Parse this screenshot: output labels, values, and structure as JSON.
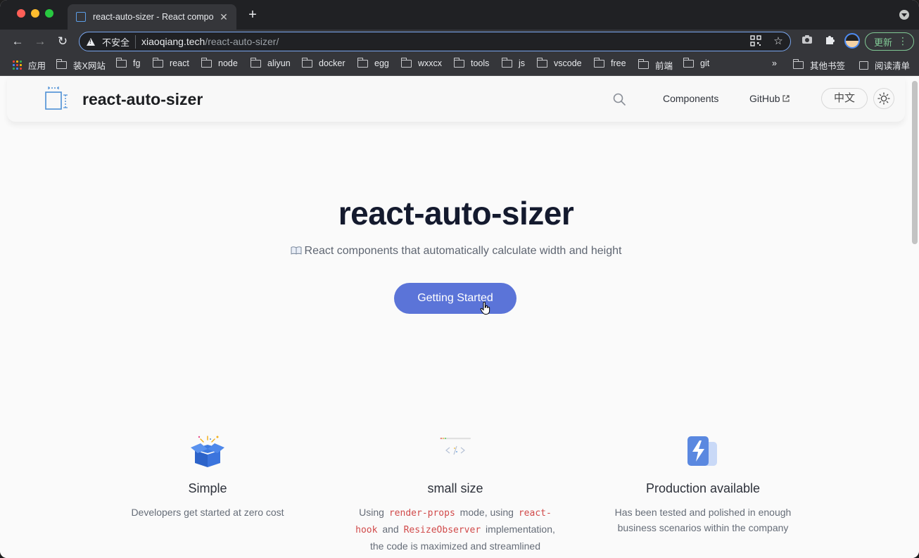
{
  "browser": {
    "tab_title": "react-auto-sizer - React compo",
    "security_label": "不安全",
    "url_host": "xiaoqiang.tech",
    "url_path": "/react-auto-sizer/",
    "update_label": "更新",
    "bookmarks": [
      {
        "label": "应用",
        "icon": "apps-grid-icon"
      },
      {
        "label": "装X网站",
        "icon": "folder-icon"
      },
      {
        "label": "fg",
        "icon": "folder-icon"
      },
      {
        "label": "react",
        "icon": "folder-icon"
      },
      {
        "label": "node",
        "icon": "folder-icon"
      },
      {
        "label": "aliyun",
        "icon": "folder-icon"
      },
      {
        "label": "docker",
        "icon": "folder-icon"
      },
      {
        "label": "egg",
        "icon": "folder-icon"
      },
      {
        "label": "wxxcx",
        "icon": "folder-icon"
      },
      {
        "label": "tools",
        "icon": "folder-icon"
      },
      {
        "label": "js",
        "icon": "folder-icon"
      },
      {
        "label": "vscode",
        "icon": "folder-icon"
      },
      {
        "label": "free",
        "icon": "folder-icon"
      },
      {
        "label": "前端",
        "icon": "folder-icon"
      },
      {
        "label": "git",
        "icon": "folder-icon"
      }
    ],
    "overflow_label": "»",
    "other_bookmarks": "其他书签",
    "reading_list": "阅读清单"
  },
  "site": {
    "title": "react-auto-sizer",
    "nav": {
      "components": "Components",
      "github": "GitHub",
      "lang": "中文"
    }
  },
  "hero": {
    "title": "react-auto-sizer",
    "description": "React components that automatically calculate width and height",
    "cta": "Getting Started"
  },
  "features": [
    {
      "title": "Simple",
      "icon": "gift-box-icon",
      "desc": "Developers get started at zero cost"
    },
    {
      "title": "small size",
      "icon": "code-window-icon",
      "desc_parts": {
        "t1": "Using",
        "c1": "render-props",
        "t2": "mode, using",
        "c2": "react-hook",
        "t3": "and",
        "c3": "ResizeObserver",
        "t4": "implementation, the code is maximized and streamlined"
      }
    },
    {
      "title": "Production available",
      "icon": "lightning-icon",
      "desc": "Has been tested and polished in enough business scenarios within the company"
    }
  ],
  "colors": {
    "accent": "#5b74d8",
    "code": "#d14a4a",
    "title": "#141a2e"
  }
}
